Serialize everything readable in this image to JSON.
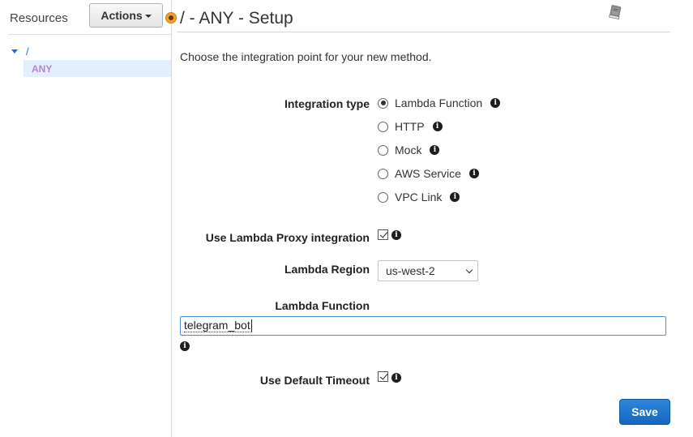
{
  "sidebar": {
    "title": "Resources",
    "actions_label": "Actions",
    "tree": {
      "root_label": "/",
      "child_label": "ANY"
    }
  },
  "main": {
    "title": "/ - ANY - Setup",
    "intro": "Choose the integration point for your new method.",
    "integration_type": {
      "label": "Integration type",
      "options": [
        {
          "label": "Lambda Function",
          "selected": true
        },
        {
          "label": "HTTP",
          "selected": false
        },
        {
          "label": "Mock",
          "selected": false
        },
        {
          "label": "AWS Service",
          "selected": false
        },
        {
          "label": "VPC Link",
          "selected": false
        }
      ]
    },
    "proxy": {
      "label": "Use Lambda Proxy integration",
      "checked": true
    },
    "region": {
      "label": "Lambda Region",
      "value": "us-west-2"
    },
    "function": {
      "label": "Lambda Function",
      "value": "telegram_bot"
    },
    "timeout": {
      "label": "Use Default Timeout",
      "checked": true
    },
    "save_label": "Save"
  },
  "icons": {
    "info": "info-icon",
    "book": "book-icon",
    "status": "status-dot-icon"
  },
  "colors": {
    "accent_blue": "#1a6fc9",
    "selected_bg": "#e3f0fb",
    "method_label": "#b57fd6",
    "save_button": "#1f77cc",
    "status_orange": "#f0a030"
  }
}
